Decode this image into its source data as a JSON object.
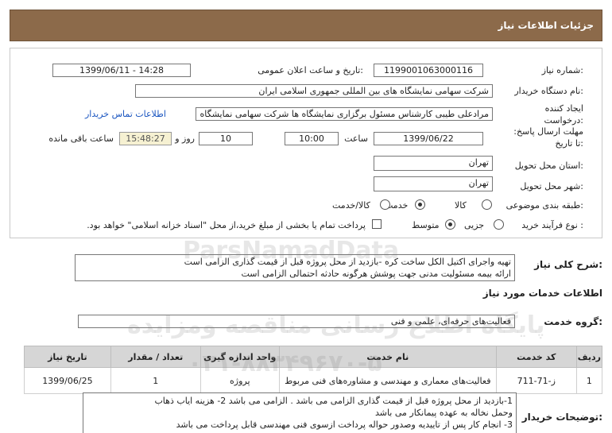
{
  "header": {
    "title": "جزئیات اطلاعات نیاز"
  },
  "labels": {
    "need_number": "شماره نیاز:",
    "announce_datetime": "تاریخ و ساعت اعلان عمومی:",
    "buyer_org": "نام دستگاه خریدار:",
    "requester": "ایجاد کننده درخواست:",
    "deadline": "مهلت ارسال پاسخ: تا تاریخ:",
    "hour": "ساعت",
    "day_and": "روز و",
    "remaining": "ساعت باقی مانده",
    "province": "استان محل تحویل:",
    "city": "شهر محل تحویل:",
    "category": "طبقه بندی موضوعی:",
    "process_type": "نوع فرآیند خرید :",
    "need_description": "شرح کلی نیاز:",
    "services_info": "اطلاعات خدمات مورد نیاز",
    "service_group": "گروه خدمت:",
    "buyer_notes": "توضیحات خریدار:"
  },
  "fields": {
    "need_number": "1199001063000116",
    "announce_datetime": "1399/06/11 - 14:28",
    "buyer_org": "شرکت سهامی نمایشگاه های بین المللی جمهوری اسلامی ایران",
    "requester": "مرادعلی طیبی کارشناس مسئول برگزاری نمایشگاه ها شرکت سهامی نمایشگاه",
    "contact_link": "اطلاعات تماس خریدار",
    "deadline_date": "1399/06/22",
    "deadline_time": "10:00",
    "days_remaining": "10",
    "countdown": "15:48:27",
    "province": "تهران",
    "city": "تهران"
  },
  "category_options": [
    {
      "label": "کالا",
      "selected": false
    },
    {
      "label": "خدمت",
      "selected": true
    },
    {
      "label": "کالا/خدمت",
      "selected": false
    }
  ],
  "process_options": [
    {
      "label": "جزیی",
      "selected": false
    },
    {
      "label": "متوسط",
      "selected": true
    }
  ],
  "treasury_note": "پرداخت تمام یا بخشی از مبلغ خرید،از محل \"اسناد خزانه اسلامی\" خواهد بود.",
  "need_description_lines": [
    "تهیه واجرای اکتیل الکل ساخت کره -بازدید از محل پروژه قبل از قیمت گذاری الزامی است",
    "ارائه بیمه مسئولیت مدنی جهت پوشش هرگونه حادثه احتمالی الزامی است"
  ],
  "service_group_value": "فعالیت‌های حرفه‌ای، علمی و فنی",
  "table": {
    "headers": [
      "ردیف",
      "کد خدمت",
      "نام خدمت",
      "واحد اندازه گیری",
      "تعداد / مقدار",
      "تاریخ نیاز"
    ],
    "rows": [
      [
        "1",
        "ز-71-711",
        "فعالیت‌های معماری و مهندسی و مشاوره‌های فنی مربوط",
        "پروژه",
        "1",
        "1399/06/25"
      ]
    ]
  },
  "buyer_notes_lines": [
    "1-بازدید از محل پروژه قبل از قیمت گذاری الزامی می باشد . الزامی می باشد 2- هزینه ایاب ذهاب",
    "وحمل نخاله به عهده پیمانکار می باشد",
    "3- انجام کار پس از تاییدیه وصدور حواله پرداخت ازسوی فنی مهندسی قابل پرداخت می باشد"
  ],
  "watermark": {
    "line1": "ParsNamadData",
    "line2": "پایگاه اطلاع رسانی مناقصه ومزایده",
    "line3": "۰۲۱-۸۸۳۴۹۶۷۰-۵"
  }
}
